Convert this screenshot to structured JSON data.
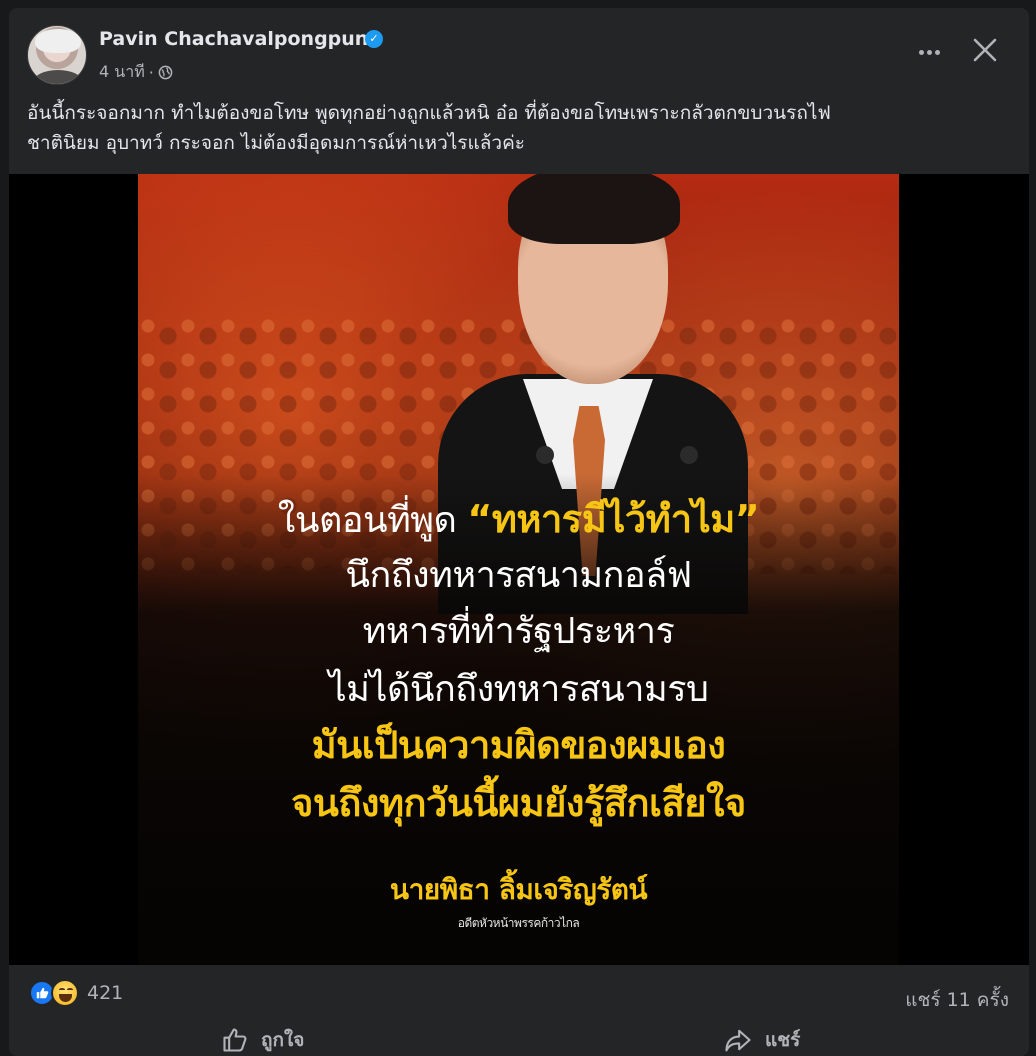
{
  "post": {
    "author": "Pavin Chachavalpongpun",
    "timestamp": "4 นาที",
    "separator": "·",
    "caption_line1": "อันนี้กระจอกมาก ทำไมต้องขอโทษ พูดทุกอย่างถูกแล้วหนิ อ๋อ ที่ต้องขอโทษเพราะกลัวตกขบวนรถไฟ",
    "caption_line2": "ชาตินิยม อุบาทว์ กระจอก ไม่ต้องมีอุดมการณ์ห่าเหวไรแล้วค่ะ"
  },
  "image": {
    "line1_prefix": "ในตอนที่พูด ",
    "line1_quote": "“ทหารมีไว้ทำไม”",
    "line2": "นึกถึงทหารสนามกอล์ฟ",
    "line3": "ทหารที่ทำรัฐประหาร",
    "line4": "ไม่ได้นึกถึงทหารสนามรบ",
    "line5": "มันเป็นความผิดของผมเอง",
    "line6": "จนถึงทุกวันนี้ผมยังรู้สึกเสียใจ",
    "signature_name": "นายพิธา ลิ้มเจริญรัตน์",
    "signature_title": "อดีตหัวหน้าพรรคก้าวไกล"
  },
  "footer": {
    "reaction_count": "421",
    "shares": "แชร์ 11 ครั้ง",
    "like_label": "ถูกใจ",
    "share_label": "แชร์"
  },
  "icons": [
    "verified-badge-icon",
    "globe-icon",
    "more-options-icon",
    "close-icon",
    "like-reaction-icon",
    "haha-reaction-icon",
    "thumbs-up-icon",
    "share-arrow-icon"
  ],
  "colors": {
    "background": "#18191a",
    "card": "#242526",
    "text_primary": "#e4e6eb",
    "text_secondary": "#b0b3b8",
    "accent_yellow": "#f7c614",
    "like_blue": "#1877f2"
  }
}
